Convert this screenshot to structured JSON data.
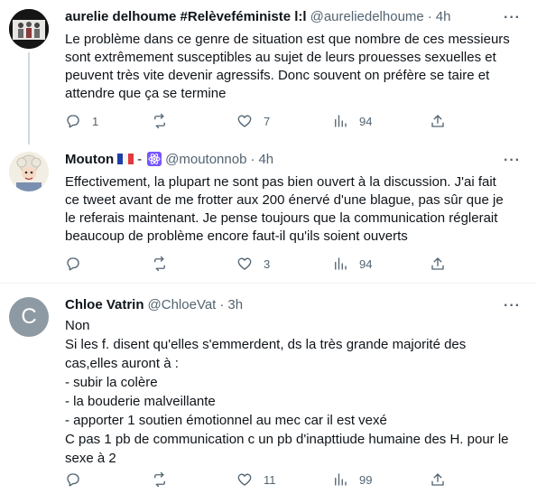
{
  "tweets": [
    {
      "name": "aurelie delhoume #Relèveféministe l:l",
      "handle": "@aureliedelhoume",
      "dot": "·",
      "time": "4h",
      "lines": [
        "Le problème dans ce genre de situation est que nombre de ces messieurs",
        "sont extrêmement susceptibles au sujet de leurs prouesses sexuelles et",
        "peuvent très vite devenir agressifs. Donc souvent on préfère se taire et",
        "attendre que ça se termine"
      ],
      "replies": "1",
      "retweets": "",
      "likes": "7",
      "views": "94"
    },
    {
      "name": "Mouton",
      "name_suffix": "-",
      "handle": "@moutonnob",
      "dot": "·",
      "time": "4h",
      "lines": [
        "Effectivement, la plupart ne sont pas bien ouvert à la discussion. J'ai fait",
        "ce tweet avant de me frotter aux 200 énervé d'une blague, pas sûr que je",
        "le referais maintenant. Je pense toujours que la communication réglerait",
        "beaucoup de problème encore faut-il qu'ils soient ouverts"
      ],
      "replies": "",
      "retweets": "",
      "likes": "3",
      "views": "94"
    },
    {
      "name": "Chloe Vatrin",
      "handle": "@ChloeVat",
      "dot": "·",
      "time": "3h",
      "avatar_letter": "C",
      "lines": [
        "Non",
        "Si les f. disent qu'elles s'emmerdent, ds la très grande majorité des",
        "cas,elles auront à :",
        "- subir la colère",
        "- la bouderie malveillante",
        "- apporter 1 soutien émotionnel au mec car il est vexé",
        "C pas 1 pb de communication c un pb d'inapttiude humaine des H. pour le",
        "sexe à 2"
      ],
      "replies": "",
      "retweets": "",
      "likes": "11",
      "views": "99"
    }
  ],
  "more_label": "···",
  "colors": {
    "text": "#0f1419",
    "secondary": "#536471",
    "divider": "#eff3f4",
    "thread_line": "#cfd9de",
    "avatar_c_bg": "#8d9aa3",
    "badge": "#7856ff"
  },
  "icons": [
    "reply-icon",
    "retweet-icon",
    "like-icon",
    "views-icon",
    "share-icon",
    "more-icon",
    "flag-fr-icon",
    "atom-icon"
  ]
}
